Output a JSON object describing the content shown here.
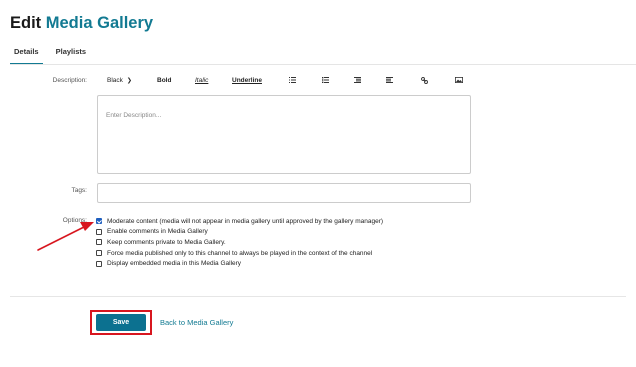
{
  "header": {
    "title_prefix": "Edit",
    "title_accent": "Media Gallery"
  },
  "tabs": [
    {
      "label": "Details",
      "active": true
    },
    {
      "label": "Playlists",
      "active": false
    }
  ],
  "form": {
    "description_label": "Description:",
    "toolbar": {
      "color": "Black",
      "bold": "Bold",
      "italic": "Italic",
      "underline": "Underline",
      "icons": [
        "unordered-list-icon",
        "ordered-list-icon",
        "outdent-icon",
        "indent-icon",
        "link-icon",
        "image-icon"
      ]
    },
    "description_placeholder": "Enter Description...",
    "tags_label": "Tags:",
    "options_label": "Options:",
    "options": [
      {
        "label": "Moderate content (media will not appear in media gallery until approved by the gallery manager)",
        "checked": true
      },
      {
        "label": "Enable comments in Media Gallery",
        "checked": false
      },
      {
        "label": "Keep comments private to Media Gallery.",
        "checked": false
      },
      {
        "label": "Force media published only to this channel to always be played in the context of the channel",
        "checked": false
      },
      {
        "label": "Display embedded media in this Media Gallery",
        "checked": false
      }
    ]
  },
  "actions": {
    "save_label": "Save",
    "back_label": "Back to Media Gallery"
  },
  "colors": {
    "accent": "#127a92",
    "save_button": "#0c7190",
    "annotation_red": "#d8161f",
    "checkbox_checked": "#1f5fbf"
  }
}
